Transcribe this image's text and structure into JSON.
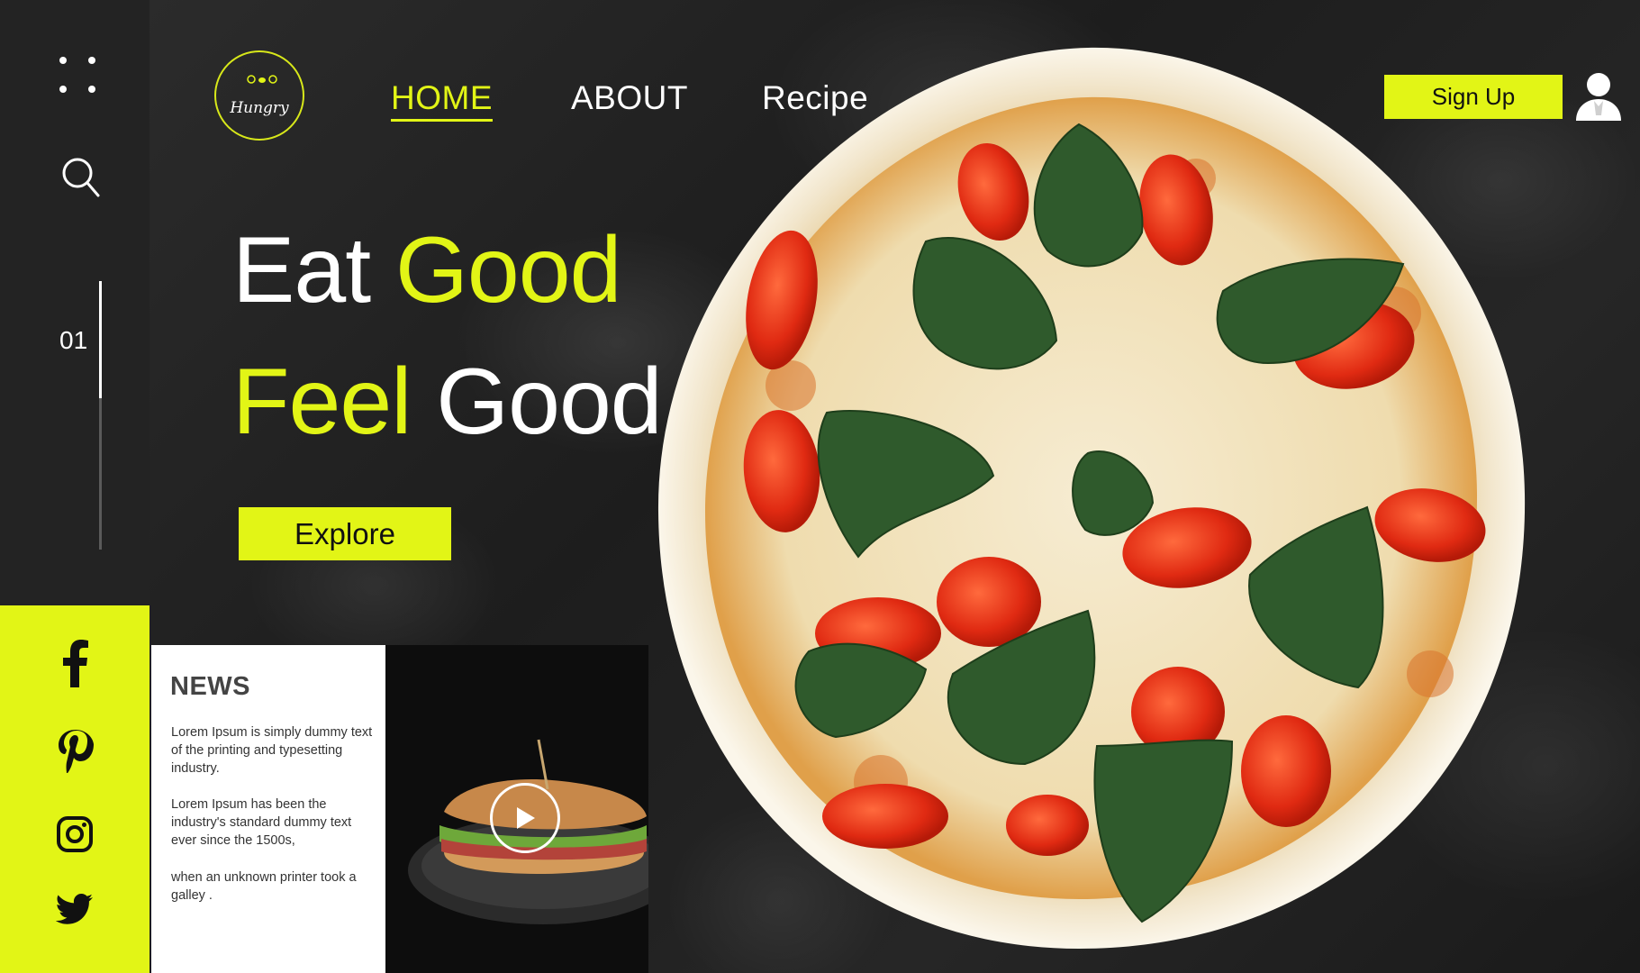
{
  "brand": {
    "logo_text": "Hungry"
  },
  "nav": {
    "items": [
      {
        "label": "HOME",
        "active": true
      },
      {
        "label": "ABOUT",
        "active": false
      },
      {
        "label": "Recipe",
        "active": false
      }
    ]
  },
  "header": {
    "signup_label": "Sign Up",
    "user_icon": "user-icon"
  },
  "sidebar": {
    "menu_icon": "grid-dots-icon",
    "search_icon": "search-icon",
    "slide_number": "01"
  },
  "hero": {
    "line1": {
      "a": "Eat",
      "b": "Good"
    },
    "line2": {
      "a": "Feel",
      "b": "Good"
    },
    "explore_label": "Explore"
  },
  "news": {
    "title": "NEWS",
    "p1": "Lorem Ipsum is simply dummy text of the printing and typesetting industry.",
    "p2": "Lorem Ipsum has been the  industry's standard dummy text ever since the 1500s,",
    "p3": "when an unknown printer took a galley ."
  },
  "social": [
    "facebook-icon",
    "pinterest-icon",
    "instagram-icon",
    "twitter-icon"
  ],
  "colors": {
    "accent": "#e2f516",
    "sidebar": "#232323",
    "background": "#1e1e1e"
  }
}
